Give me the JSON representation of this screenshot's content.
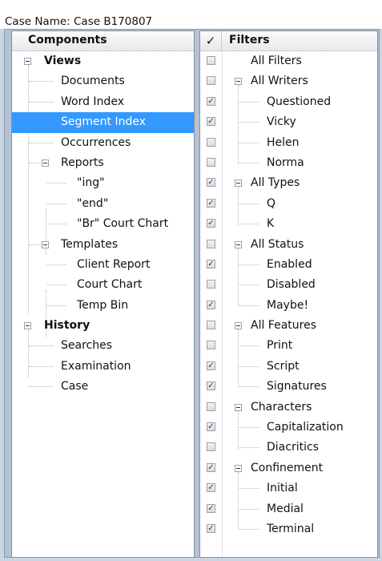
{
  "window": {
    "title": "Case Name: Case B170807"
  },
  "components": {
    "header": "Components",
    "views": {
      "label": "Views",
      "items": [
        "Documents",
        "Word Index",
        "Segment Index",
        "Occurrences"
      ],
      "reports": {
        "label": "Reports",
        "items": [
          "\"ing\"",
          "\"end\"",
          "\"Br\" Court Chart"
        ]
      },
      "templates": {
        "label": "Templates",
        "items": [
          "Client Report",
          "Court Chart",
          "Temp Bin"
        ]
      }
    },
    "history": {
      "label": "History",
      "items": [
        "Searches",
        "Examination",
        "Case"
      ]
    },
    "selected_item": "Segment Index"
  },
  "filters": {
    "check_header": "✓",
    "header": "Filters",
    "checkmark_glyph": "✓",
    "all": {
      "label": "All Filters",
      "checked": false
    },
    "writers": {
      "label": "All Writers",
      "checked": false,
      "items": [
        {
          "label": "Questioned",
          "checked": true
        },
        {
          "label": "Vicky",
          "checked": true
        },
        {
          "label": "Helen",
          "checked": false
        },
        {
          "label": "Norma",
          "checked": false
        }
      ]
    },
    "types": {
      "label": "All Types",
      "checked": true,
      "items": [
        {
          "label": "Q",
          "checked": true
        },
        {
          "label": "K",
          "checked": true
        }
      ]
    },
    "status": {
      "label": "All Status",
      "checked": false,
      "items": [
        {
          "label": "Enabled",
          "checked": true
        },
        {
          "label": "Disabled",
          "checked": false
        },
        {
          "label": "Maybe!",
          "checked": true
        }
      ]
    },
    "features": {
      "label": "All Features",
      "checked": false,
      "items": [
        {
          "label": "Print",
          "checked": false
        },
        {
          "label": "Script",
          "checked": true
        },
        {
          "label": "Signatures",
          "checked": true
        }
      ]
    },
    "characters": {
      "label": "Characters",
      "checked": false,
      "items": [
        {
          "label": "Capitalization",
          "checked": true
        },
        {
          "label": "Diacritics",
          "checked": false
        }
      ]
    },
    "confinement": {
      "label": "Confinement",
      "checked": true,
      "items": [
        {
          "label": "Initial",
          "checked": true
        },
        {
          "label": "Medial",
          "checked": true
        },
        {
          "label": "Terminal",
          "checked": true
        }
      ]
    }
  },
  "colors": {
    "selection": "#3399ff",
    "frame": "#b4c3d3",
    "checkmark": "#1a3a78"
  }
}
